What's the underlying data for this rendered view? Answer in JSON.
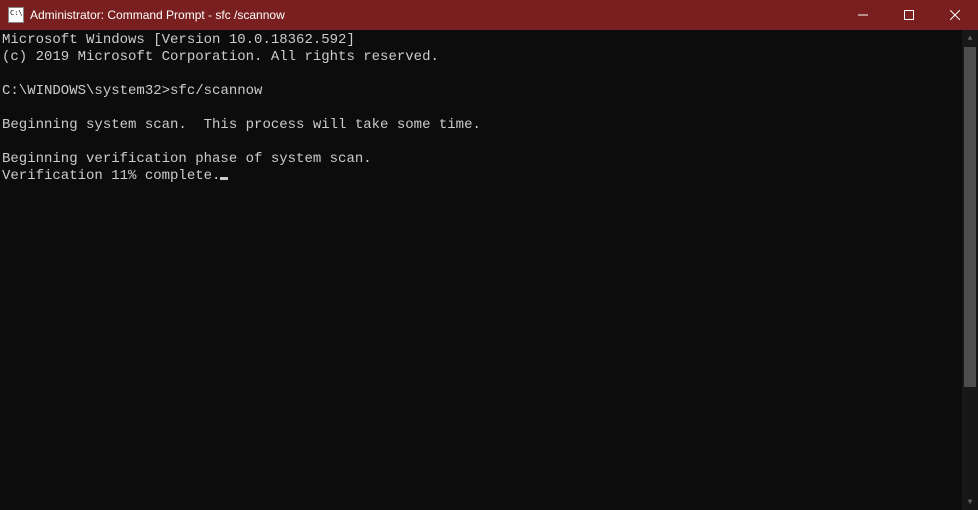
{
  "titlebar": {
    "title": "Administrator: Command Prompt - sfc /scannow"
  },
  "terminal": {
    "version_line": "Microsoft Windows [Version 10.0.18362.592]",
    "copyright_line": "(c) 2019 Microsoft Corporation. All rights reserved.",
    "prompt": "C:\\WINDOWS\\system32>",
    "command": "sfc/scannow",
    "scan_begin": "Beginning system scan.  This process will take some time.",
    "verify_begin": "Beginning verification phase of system scan.",
    "verify_progress": "Verification 11% complete."
  }
}
